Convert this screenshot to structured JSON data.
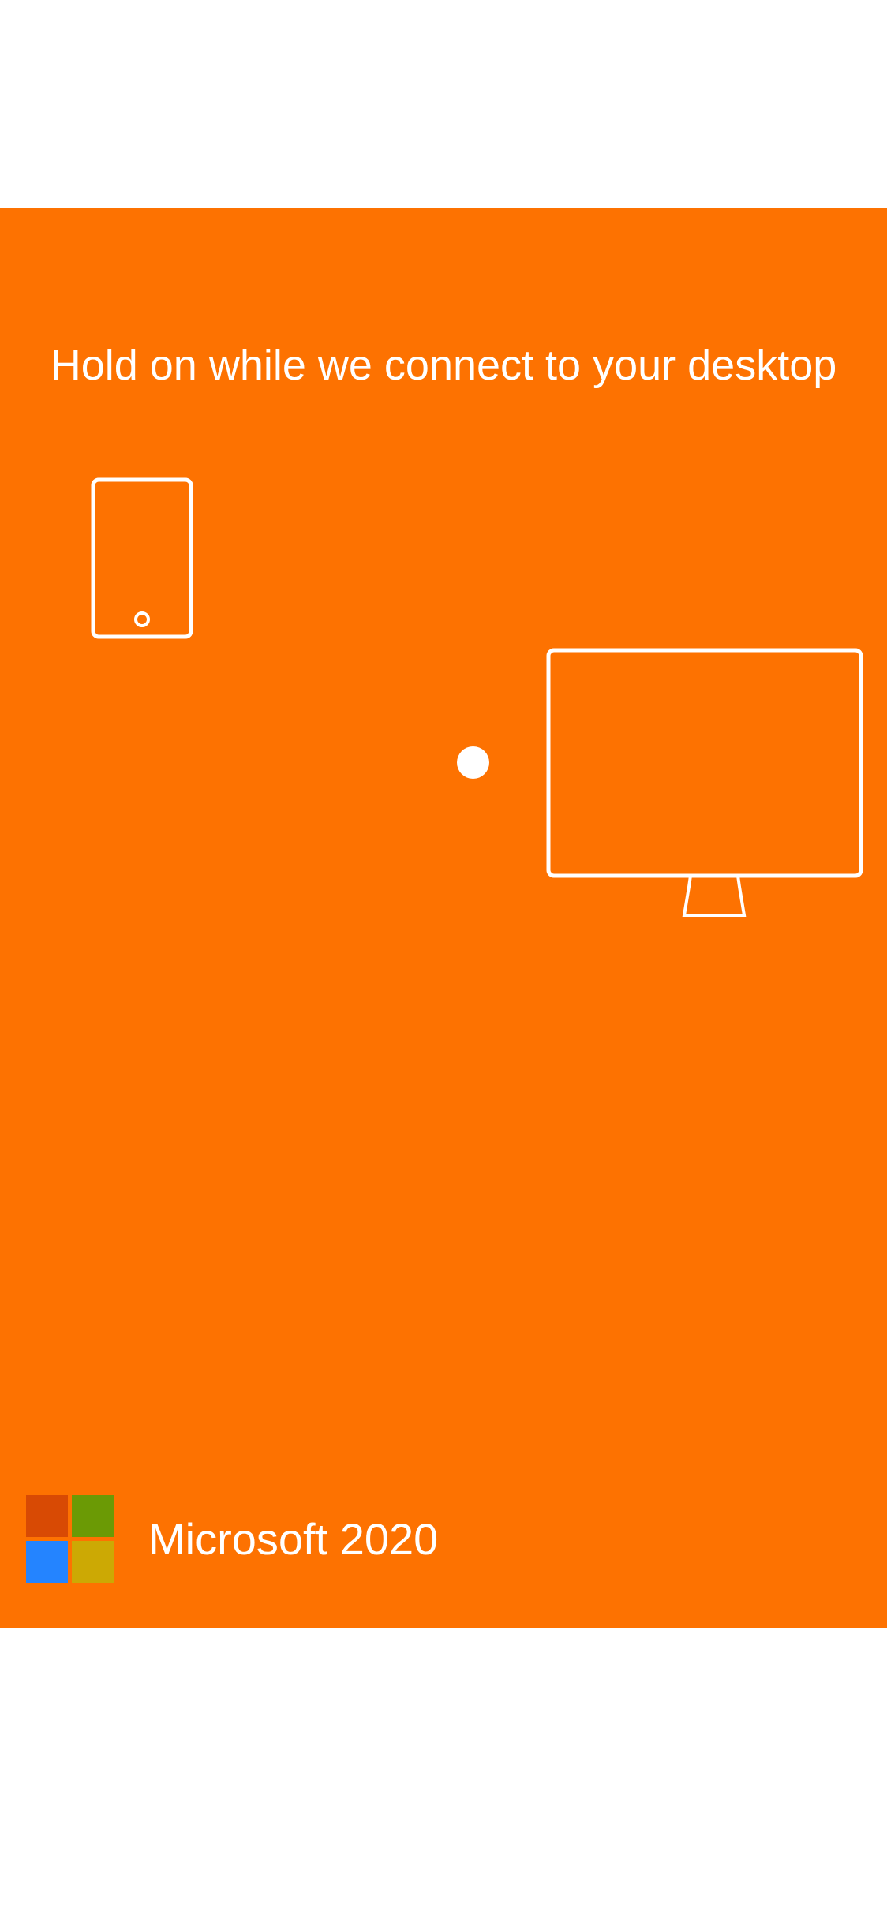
{
  "connect_screen": {
    "message": "Hold on while we connect to your desktop",
    "icons": {
      "source_device": "tablet-icon",
      "progress": "progress-dot",
      "target_device": "monitor-icon"
    }
  },
  "footer": {
    "brand": "Microsoft 2020",
    "logo": "microsoft-logo"
  },
  "colors": {
    "background_accent": "#FD7201",
    "foreground": "#FFFFFF",
    "logo_red": "#D84A04",
    "logo_green": "#6B9A05",
    "logo_blue": "#2484FF",
    "logo_yellow": "#CCA904"
  }
}
